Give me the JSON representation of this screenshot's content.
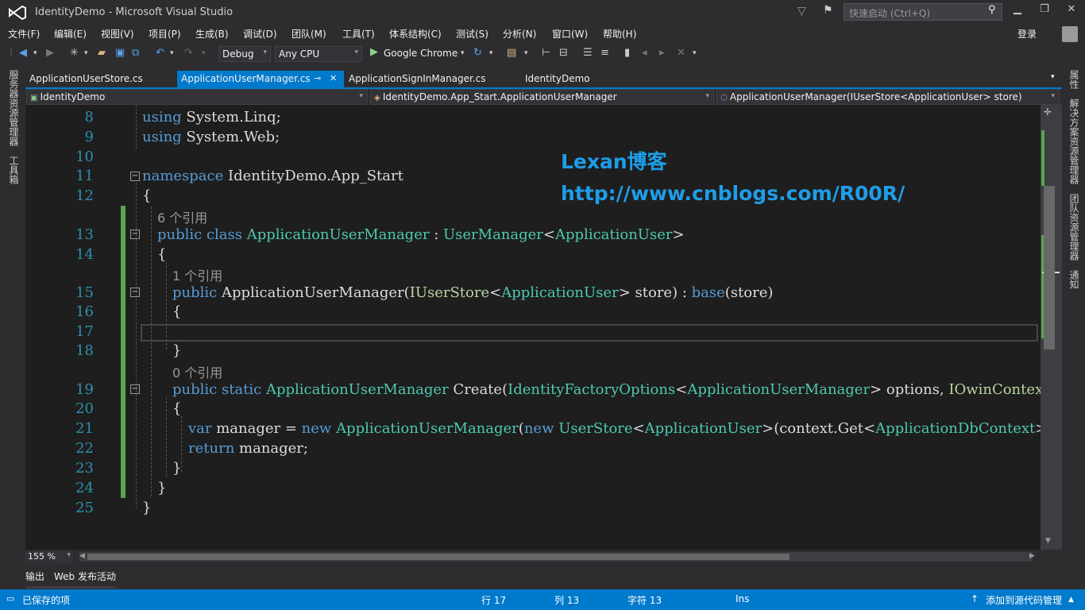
{
  "window": {
    "title": "IdentityDemo - Microsoft Visual Studio",
    "quick_launch_placeholder": "快速启动 (Ctrl+Q)",
    "minimize": "▁",
    "restore": "❐",
    "close": "✕"
  },
  "menu": {
    "items": [
      "文件(F)",
      "编辑(E)",
      "视图(V)",
      "项目(P)",
      "生成(B)",
      "调试(D)",
      "团队(M)",
      "工具(T)",
      "体系结构(C)",
      "测试(S)",
      "分析(N)",
      "窗口(W)",
      "帮助(H)"
    ],
    "login": "登录"
  },
  "toolbar": {
    "config": "Debug",
    "platform": "Any CPU",
    "run_target": "Google Chrome"
  },
  "left_panel": {
    "server_explorer": "服务器资源管理器",
    "toolbox": "工具箱"
  },
  "right_panel": {
    "properties": "属性",
    "solution_explorer": "解决方案资源管理器",
    "team_explorer": "团队资源管理器",
    "notifications": "通知"
  },
  "tabs": [
    "ApplicationUserStore.cs",
    "ApplicationUserManager.cs",
    "ApplicationSignInManager.cs",
    "IdentityDemo"
  ],
  "tab_pin": "⊸",
  "tab_close": "✕",
  "nav": {
    "project": "IdentityDemo",
    "class": "IdentityDemo.App_Start.ApplicationUserManager",
    "member": "ApplicationUserManager(IUserStore<ApplicationUser> store)"
  },
  "editor": {
    "line_numbers": [
      "8",
      "9",
      "10",
      "11",
      "12",
      "13",
      "14",
      "15",
      "16",
      "17",
      "18",
      "19",
      "20",
      "21",
      "22",
      "23",
      "24",
      "25"
    ],
    "refs": {
      "r1": "6 个引用",
      "r2": "1 个引用",
      "r3": "0 个引用"
    },
    "tokens": {
      "using": "using",
      "sys_linq": " System.Linq;",
      "sys_web": " System.Web;",
      "namespace": "namespace",
      "ns_name": " IdentityDemo.App_Start",
      "lbrace": "{",
      "rbrace": "}",
      "public": "public",
      "class": " class",
      "static": " static",
      "cls": "ApplicationUserManager",
      "colon": " : ",
      "base_cls": "UserManager",
      "lt": "<",
      "gt": ">",
      "app_user": "ApplicationUser",
      "ctor_name": " ApplicationUserManager(",
      "iuserstore": "IUserStore",
      "store_arg": "> store) : ",
      "base": "base",
      "store_end": "(store)",
      "create": " Create(",
      "ifo": "IdentityFactoryOptions",
      "opts": "> options, ",
      "iowin": "IOwinContext",
      "co": " co",
      "var": "var",
      "manager_eq": " manager = ",
      "new": "new",
      "paren": "(",
      "userstore": "UserStore",
      "ctx": ">(context.Get<",
      "dbctx": "ApplicationDbContext",
      "tail": ">()));",
      "return": "return",
      "ret_tail": " manager;"
    },
    "watermark": {
      "line1": "Lexan博客",
      "line2": "http://www.cnblogs.com/R00R/"
    }
  },
  "zoom": "155 %",
  "bottom_tabs": [
    "输出",
    "Web 发布活动"
  ],
  "status": {
    "saved": "已保存的项",
    "row": "行 17",
    "col": "列 13",
    "char": "字符 13",
    "mode": "Ins",
    "source_control": "添加到源代码管理"
  }
}
